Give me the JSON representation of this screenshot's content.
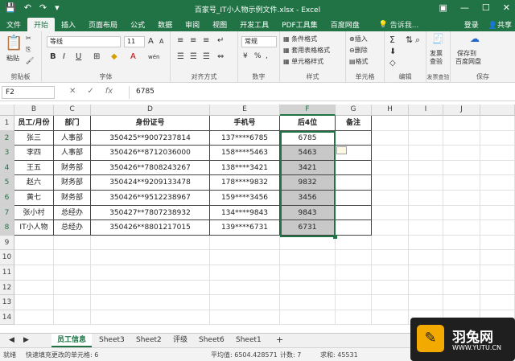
{
  "titlebar": {
    "title": "百家号_IT小人物示例文件.xlsx - Excel",
    "save_icon": "save-icon",
    "undo_icon": "undo-icon",
    "redo_icon": "redo-icon",
    "customize_icon": "customize-icon"
  },
  "ribbon_tabs": [
    "文件",
    "开始",
    "插入",
    "页面布局",
    "公式",
    "数据",
    "审阅",
    "视图",
    "开发工具",
    "PDF工具集",
    "百度网盘"
  ],
  "tell_me": "告诉我...",
  "account": {
    "login": "登录",
    "share": "共享"
  },
  "ribbon": {
    "clipboard": {
      "paste": "粘贴",
      "label": "剪贴板"
    },
    "font": {
      "name": "等线",
      "size": "11",
      "label": "字体",
      "bold": "B",
      "italic": "I",
      "underline": "U",
      "grow": "A",
      "shrink": "A",
      "color_glyph": "A",
      "wen": "wén"
    },
    "alignment": {
      "label": "对齐方式"
    },
    "number": {
      "format": "常规",
      "label": "数字"
    },
    "styles": {
      "conditional": "条件格式",
      "table": "套用表格格式",
      "cell": "单元格样式",
      "label": "样式"
    },
    "cells": {
      "insert": "插入",
      "delete": "删除",
      "format": "格式",
      "label": "单元格"
    },
    "editing": {
      "label": "编辑"
    },
    "invoice": {
      "btn1": "发票",
      "btn2": "查验",
      "label": "发票查验"
    },
    "save": {
      "btn1": "保存到",
      "btn2": "百度网盘",
      "label": "保存"
    }
  },
  "formula_bar": {
    "name_box": "F2",
    "value": "6785",
    "fx": "fx",
    "cancel": "✕",
    "enter": "✓"
  },
  "columns": [
    "B",
    "C",
    "D",
    "E",
    "F",
    "G",
    "H",
    "I",
    "J"
  ],
  "rows": [
    "1",
    "2",
    "3",
    "4",
    "5",
    "6",
    "7",
    "8",
    "9",
    "10",
    "11",
    "12",
    "13",
    "14"
  ],
  "table": {
    "headers": [
      "员工/月份",
      "部门",
      "身份证号",
      "手机号",
      "后4位",
      "备注"
    ],
    "data": [
      [
        "张三",
        "人事部",
        "350425**9007237814",
        "137****6785",
        "6785",
        ""
      ],
      [
        "李四",
        "人事部",
        "350426**8712036000",
        "158****5463",
        "5463",
        ""
      ],
      [
        "王五",
        "财务部",
        "350426**7808243267",
        "138****3421",
        "3421",
        ""
      ],
      [
        "赵六",
        "财务部",
        "350424**9209133478",
        "178****9832",
        "9832",
        ""
      ],
      [
        "黄七",
        "财务部",
        "350426**9512238967",
        "159****3456",
        "3456",
        ""
      ],
      [
        "张小村",
        "总经办",
        "350427**7807238932",
        "134****9843",
        "9843",
        ""
      ],
      [
        "IT小人物",
        "总经办",
        "350426**8801217015",
        "139****6731",
        "6731",
        ""
      ]
    ]
  },
  "sheet_tabs": [
    "员工信息",
    "Sheet3",
    "Sheet2",
    "评级",
    "Sheet6",
    "Sheet1"
  ],
  "add_sheet": "+",
  "statusbar": {
    "ready": "就绪",
    "message": "快速填充更改的单元格: 6",
    "average": "平均值: 6504.428571",
    "count": "计数: 7",
    "sum": "求和: 45531"
  },
  "watermark": {
    "title": "羽兔网",
    "url": "WWW.YUTU.CN",
    "glyph": "✎"
  }
}
